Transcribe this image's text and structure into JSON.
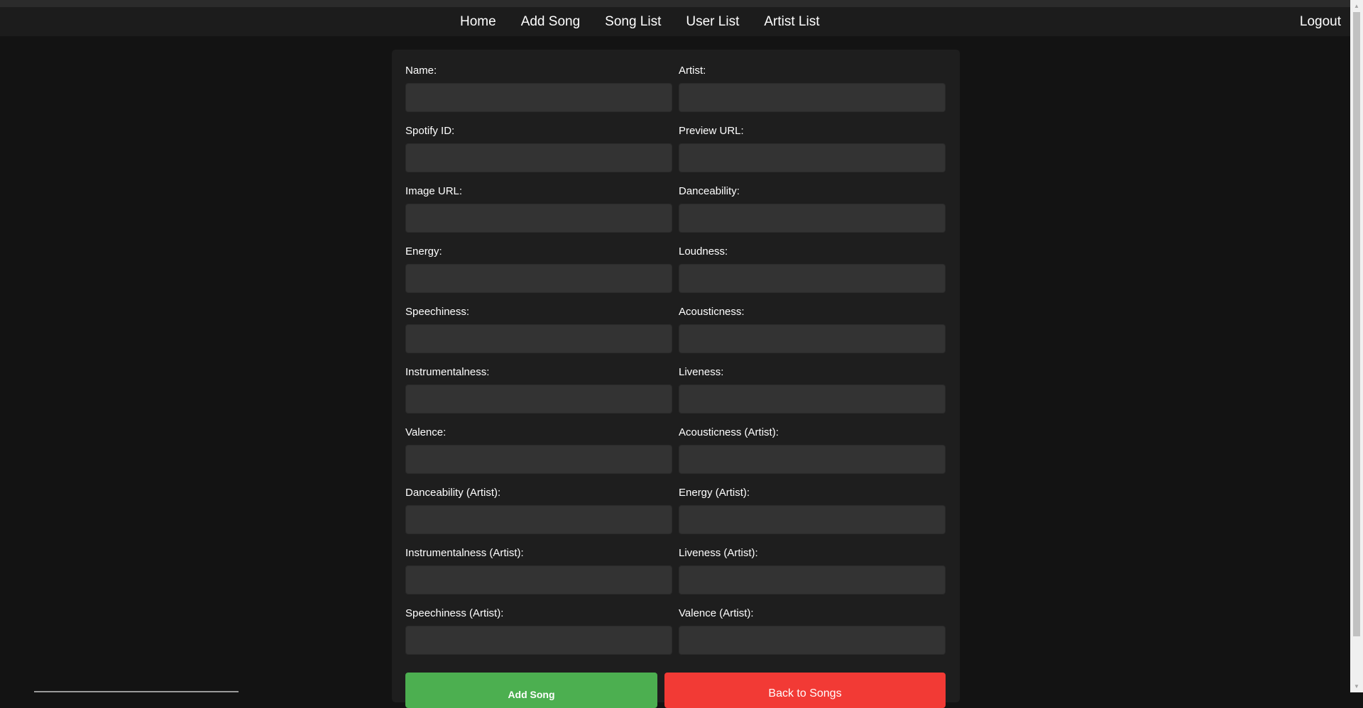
{
  "nav": {
    "links": [
      "Home",
      "Add Song",
      "Song List",
      "User List",
      "Artist List"
    ],
    "logout": "Logout"
  },
  "form": {
    "fields": [
      {
        "label": "Name:",
        "value": ""
      },
      {
        "label": "Artist:",
        "value": ""
      },
      {
        "label": "Spotify ID:",
        "value": ""
      },
      {
        "label": "Preview URL:",
        "value": ""
      },
      {
        "label": "Image URL:",
        "value": ""
      },
      {
        "label": "Danceability:",
        "value": ""
      },
      {
        "label": "Energy:",
        "value": ""
      },
      {
        "label": "Loudness:",
        "value": ""
      },
      {
        "label": "Speechiness:",
        "value": ""
      },
      {
        "label": "Acousticness:",
        "value": ""
      },
      {
        "label": "Instrumentalness:",
        "value": ""
      },
      {
        "label": "Liveness:",
        "value": ""
      },
      {
        "label": "Valence:",
        "value": ""
      },
      {
        "label": "Acousticness (Artist):",
        "value": ""
      },
      {
        "label": "Danceability (Artist):",
        "value": ""
      },
      {
        "label": "Energy (Artist):",
        "value": ""
      },
      {
        "label": "Instrumentalness (Artist):",
        "value": ""
      },
      {
        "label": "Liveness (Artist):",
        "value": ""
      },
      {
        "label": "Speechiness (Artist):",
        "value": ""
      },
      {
        "label": "Valence (Artist):",
        "value": ""
      }
    ],
    "add_button": "Add Song",
    "back_button": "Back to Songs"
  },
  "colors": {
    "page_bg": "#131313",
    "navbar_bg": "#1c1c1c",
    "card_bg": "#1e1e1e",
    "input_bg": "#333333",
    "add_button": "#4caf50",
    "back_button": "#f23a35"
  },
  "icons": {
    "scroll_up": "scroll-up-arrow-icon",
    "scroll_down": "scroll-down-arrow-icon"
  }
}
